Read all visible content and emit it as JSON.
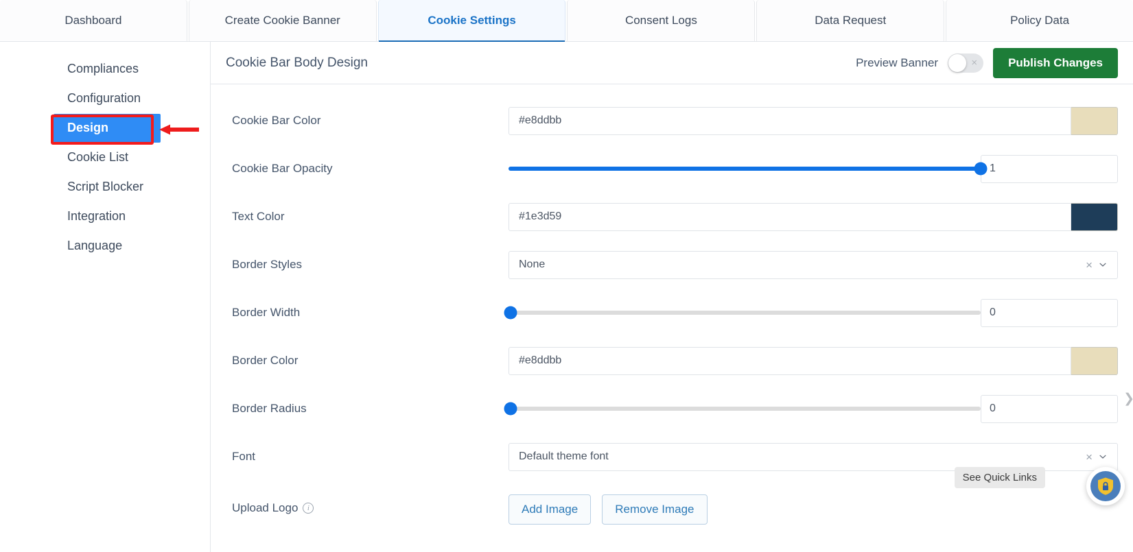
{
  "tabs": [
    {
      "label": "Dashboard",
      "active": false
    },
    {
      "label": "Create Cookie Banner",
      "active": false
    },
    {
      "label": "Cookie Settings",
      "active": true
    },
    {
      "label": "Consent Logs",
      "active": false
    },
    {
      "label": "Data Request",
      "active": false
    },
    {
      "label": "Policy Data",
      "active": false
    }
  ],
  "sidebar": {
    "items": [
      {
        "label": "Compliances",
        "active": false
      },
      {
        "label": "Configuration",
        "active": false
      },
      {
        "label": "Design",
        "active": true
      },
      {
        "label": "Cookie List",
        "active": false
      },
      {
        "label": "Script Blocker",
        "active": false
      },
      {
        "label": "Integration",
        "active": false
      },
      {
        "label": "Language",
        "active": false
      }
    ],
    "annotation": {
      "highlight_color": "#f41b1b",
      "arrow_color": "#ee1c1c",
      "target": "Design"
    }
  },
  "panel": {
    "title": "Cookie Bar Body Design",
    "preview_label": "Preview Banner",
    "preview_toggle_on": false,
    "preview_toggle_glyph": "×",
    "publish_label": "Publish Changes",
    "publish_color": "#1d7d38"
  },
  "form": {
    "cookie_bar_color": {
      "label": "Cookie Bar Color",
      "value": "#e8ddbb",
      "swatch": "#e8ddbb"
    },
    "cookie_bar_opacity": {
      "label": "Cookie Bar Opacity",
      "value": "1",
      "percent": 100,
      "fill_color": "#0f72e5"
    },
    "text_color": {
      "label": "Text Color",
      "value": "#1e3d59",
      "swatch": "#1e3d59"
    },
    "border_styles": {
      "label": "Border Styles",
      "value": "None",
      "clear_glyph": "×",
      "caret_glyph": "⌄"
    },
    "border_width": {
      "label": "Border Width",
      "value": "0",
      "percent": 0
    },
    "border_color": {
      "label": "Border Color",
      "value": "#e8ddbb",
      "swatch": "#e8ddbb"
    },
    "border_radius": {
      "label": "Border Radius",
      "value": "0",
      "percent": 0
    },
    "font": {
      "label": "Font",
      "value": "Default theme font",
      "clear_glyph": "×",
      "caret_glyph": "⌄"
    },
    "upload_logo": {
      "label": "Upload Logo",
      "info_glyph": "i",
      "add_label": "Add Image",
      "remove_label": "Remove Image"
    }
  },
  "overlay": {
    "tooltip": "See Quick Links",
    "fab_icon": "shield-lock-icon",
    "edge_caret_glyph": "❯"
  }
}
